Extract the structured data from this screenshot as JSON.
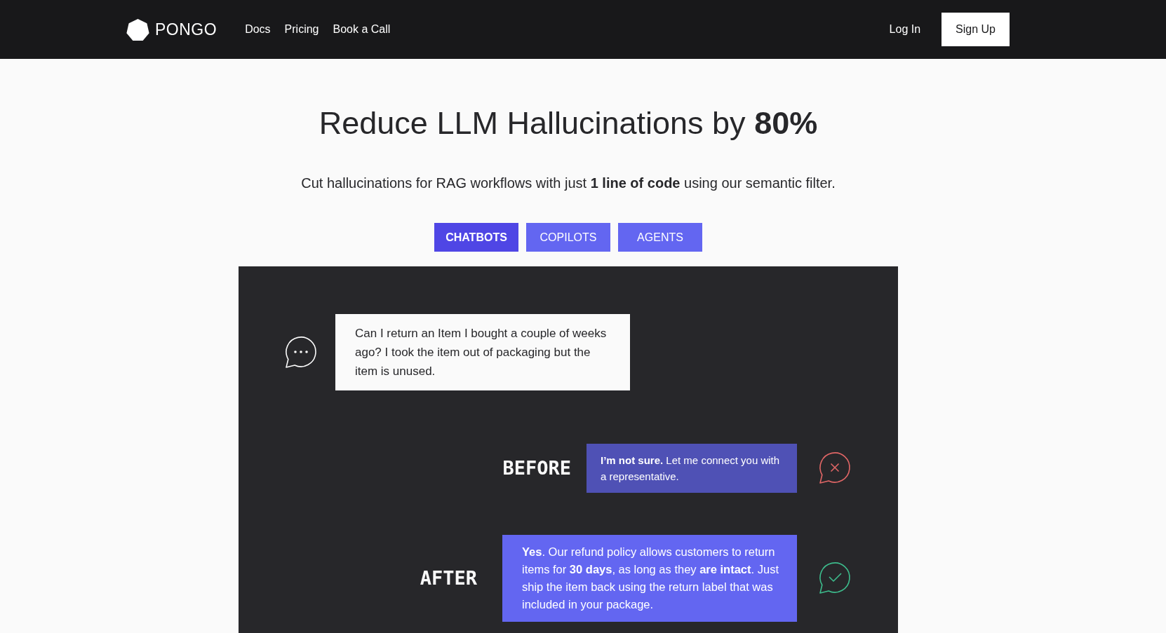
{
  "navbar": {
    "brand": "PONGO",
    "links": [
      {
        "label": "Docs"
      },
      {
        "label": "Pricing"
      },
      {
        "label": "Book a Call"
      }
    ],
    "login": "Log In",
    "signup": "Sign Up"
  },
  "hero": {
    "title": "Reduce LLM Hallucinations by **80%**",
    "subtitle": "Cut hallucinations for RAG workflows with just **1 line of code** using our semantic filter."
  },
  "tabs": [
    {
      "label": "CHATBOTS",
      "selected": true
    },
    {
      "label": "COPILOTS",
      "selected": false
    },
    {
      "label": "AGENTS",
      "selected": false
    }
  ],
  "demo": {
    "question": "Can I return an Item I bought a couple of weeks ago? I took the item out of packaging but the item is unused.",
    "responses": [
      {
        "label": "BEFORE",
        "kind": "wrong",
        "text": "**I’m not sure.** Let me connect you with a representative."
      },
      {
        "label": "AFTER",
        "kind": "correct",
        "text": "**Yes**. Our refund policy allows customers to return items for **30 days**, as long as they **are intact**. Just ship the item back using the return label that was included in your package."
      }
    ]
  }
}
